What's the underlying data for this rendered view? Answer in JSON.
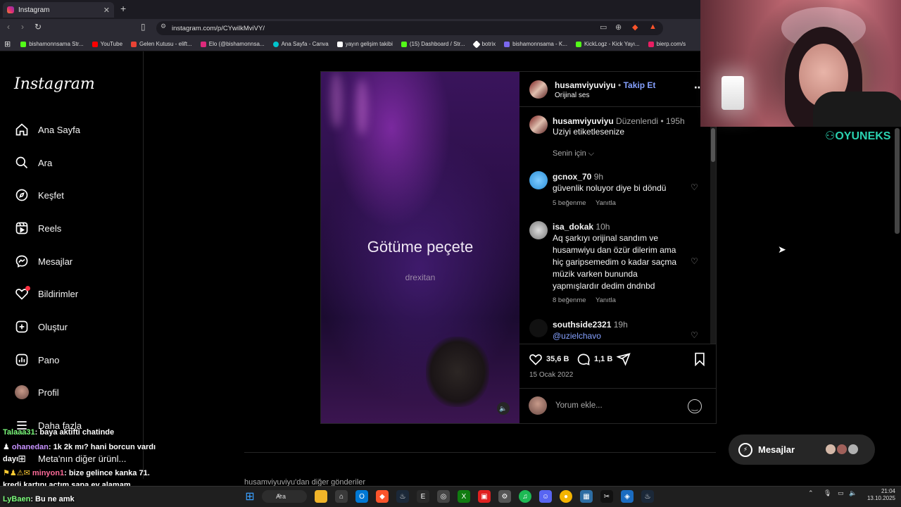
{
  "browser": {
    "tab_title": "Instagram",
    "url": "instagram.com/p/CYwilkMviVY/",
    "bookmarks": [
      {
        "label": "bishamonnsama Str...",
        "color": "#53fc18"
      },
      {
        "label": "YouTube",
        "color": "#ff0000"
      },
      {
        "label": "Gelen Kutusu - elift...",
        "color": "#ea4335"
      },
      {
        "label": "Elo (@bishamonnsa...",
        "color": "#dd2a7b"
      },
      {
        "label": "Ana Sayfa - Canva",
        "color": "#00c4cc"
      },
      {
        "label": "yayın gelişim takibi",
        "color": "#ffffff"
      },
      {
        "label": "(15) Dashboard / Str...",
        "color": "#53fc18"
      },
      {
        "label": "botrix",
        "color": "#ffffff"
      },
      {
        "label": "bishamonnsama - K...",
        "color": "#7b68ee"
      },
      {
        "label": "KickLogz - Kick Yayı...",
        "color": "#53fc18"
      },
      {
        "label": "bierp.com/s",
        "color": "#e91e63"
      }
    ]
  },
  "sidebar": {
    "logo": "Instagram",
    "items": [
      {
        "label": "Ana Sayfa",
        "icon": "home-icon"
      },
      {
        "label": "Ara",
        "icon": "search-icon"
      },
      {
        "label": "Keşfet",
        "icon": "compass-icon"
      },
      {
        "label": "Reels",
        "icon": "reels-icon"
      },
      {
        "label": "Mesajlar",
        "icon": "messenger-icon"
      },
      {
        "label": "Bildirimler",
        "icon": "heart-icon"
      },
      {
        "label": "Oluştur",
        "icon": "plus-square-icon"
      },
      {
        "label": "Pano",
        "icon": "dashboard-icon"
      },
      {
        "label": "Profil",
        "icon": "profile-avatar"
      },
      {
        "label": "Daha fazla",
        "icon": "menu-icon"
      }
    ],
    "meta_text": "Meta'nın diğer ürünl..."
  },
  "video": {
    "caption": "Götüme peçete",
    "watermark": "drexitan"
  },
  "post": {
    "username": "husamviyuviyu",
    "follow": "Takip Et",
    "audio": "Orijinal ses",
    "caption_user": "husamviyuviyu",
    "caption_edited": "Düzenlendi",
    "caption_time": "195h",
    "caption_text": "Uziyi etiketlesenize",
    "sort_label": "Senin için",
    "comments": [
      {
        "user": "gcnox_70",
        "time": "9h",
        "text": "güvenlik noluyor diye bi döndü",
        "likes": "5 beğenme",
        "reply": "Yanıtla"
      },
      {
        "user": "isa_dokak",
        "time": "10h",
        "text": "Aq şarkıyı orijinal sandım ve husamwiyu dan özür dilerim ama hiç garipsemedim o kadar saçma müzik varken bununda yapmışlardır dedim dndnbd",
        "likes": "8 beğenme",
        "reply": "Yanıtla"
      },
      {
        "user": "southside2321",
        "time": "19h",
        "text": "@uzielchavo"
      }
    ],
    "likes_count": "35,6 B",
    "comments_count": "1,1 B",
    "date": "15 Ocak 2022",
    "comment_placeholder": "Yorum ekle..."
  },
  "more_posts": "husamviyuviyu'dan diğer gönderiler",
  "messages_pill": "Mesajlar",
  "stream_overlay": {
    "brand": "OYUNEKS",
    "chat": [
      {
        "user": "Talaaa31",
        "text": ": baya aktifti chatinde",
        "color": "#7cfc7c"
      },
      {
        "user": "ohanedan",
        "text": ": 1k 2k mı? hani borcun vardı",
        "color": "#c792ff"
      },
      {
        "user": "",
        "text": "dayı",
        "color": "#ffffff"
      },
      {
        "user": "minyon1",
        "text": ": bize gelince kanka 71.",
        "color": "#ff6b9a"
      },
      {
        "user": "",
        "text": "kredi kartını açtım sana ev alamam",
        "color": "#ffffff"
      },
      {
        "user": "LyBaen",
        "text": ": Bu ne amk",
        "color": "#7cfc7c"
      }
    ]
  },
  "taskbar": {
    "search": "Ara",
    "time": "21:04",
    "date": "13.10.2025"
  }
}
